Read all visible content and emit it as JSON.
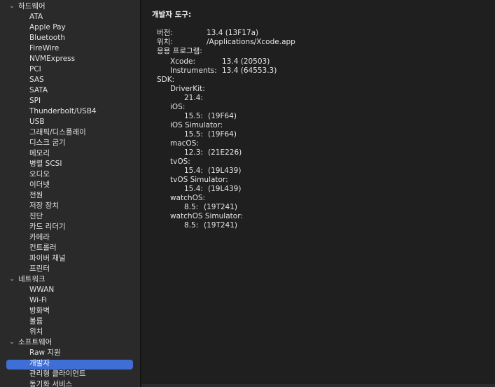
{
  "sidebar": {
    "groups": [
      {
        "label": "하드웨어",
        "chevron": "⌄",
        "items": [
          "ATA",
          "Apple Pay",
          "Bluetooth",
          "FireWire",
          "NVMExpress",
          "PCI",
          "SAS",
          "SATA",
          "SPI",
          "Thunderbolt/USB4",
          "USB",
          "그래픽/디스플레이",
          "디스크 굽기",
          "메모리",
          "병렬 SCSI",
          "오디오",
          "이더넷",
          "전원",
          "저장 장치",
          "진단",
          "카드 리더기",
          "카메라",
          "컨트롤러",
          "파이버 채널",
          "프린터"
        ]
      },
      {
        "label": "네트워크",
        "chevron": "⌄",
        "items": [
          "WWAN",
          "Wi-Fi",
          "방화벽",
          "볼륨",
          "위치"
        ]
      },
      {
        "label": "소프트웨어",
        "chevron": "⌄",
        "items": [
          "Raw 지원",
          "개발자",
          "관리형 클라이언트",
          "동기화 서비스"
        ]
      }
    ],
    "selected": "개발자",
    "accent_color": "#3f6fd6"
  },
  "detail": {
    "title": "개발자 도구:",
    "version_label": "버전:",
    "version_value": "13.4 (13F17a)",
    "location_label": "위치:",
    "location_value": "/Applications/Xcode.app",
    "apps_label": "응용 프로그램:",
    "xcode_label": "Xcode:",
    "xcode_value": "13.4 (20503)",
    "instruments_label": "Instruments:",
    "instruments_value": "13.4 (64553.3)",
    "sdk_label": "SDK:",
    "sdks": [
      {
        "name": "DriverKit:",
        "version": "21.4:",
        "build": ""
      },
      {
        "name": "iOS:",
        "version": "15.5:",
        "build": "(19F64)"
      },
      {
        "name": "iOS Simulator:",
        "version": "15.5:",
        "build": "(19F64)"
      },
      {
        "name": "macOS:",
        "version": "12.3:",
        "build": "(21E226)"
      },
      {
        "name": "tvOS:",
        "version": "15.4:",
        "build": "(19L439)"
      },
      {
        "name": "tvOS Simulator:",
        "version": "15.4:",
        "build": "(19L439)"
      },
      {
        "name": "watchOS:",
        "version": "8.5:",
        "build": "(19T241)"
      },
      {
        "name": "watchOS Simulator:",
        "version": "8.5:",
        "build": "(19T241)"
      }
    ]
  }
}
